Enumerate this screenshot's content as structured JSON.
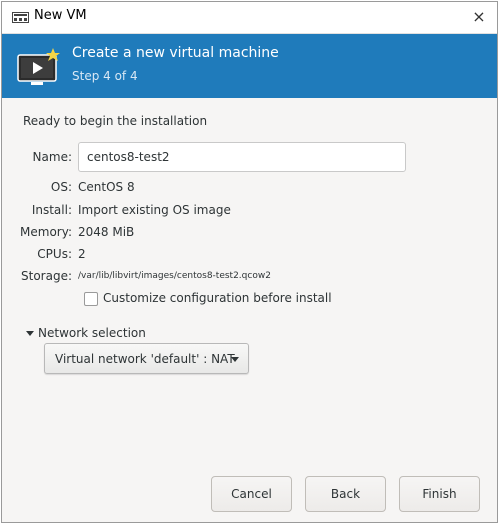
{
  "window": {
    "title": "New VM",
    "close_glyph": "×"
  },
  "banner": {
    "heading": "Create a new virtual machine",
    "step": "Step 4 of 4",
    "icon": "vm-monitor-icon"
  },
  "summary": {
    "ready_text": "Ready to begin the installation",
    "name_label": "Name:",
    "name_value": "centos8-test2",
    "os_label": "OS:",
    "os_value": "CentOS 8",
    "install_label": "Install:",
    "install_value": "Import existing OS image",
    "memory_label": "Memory:",
    "memory_value": "2048 MiB",
    "cpus_label": "CPUs:",
    "cpus_value": "2",
    "storage_label": "Storage:",
    "storage_value": "/var/lib/libvirt/images/centos8-test2.qcow2",
    "customize_label": "Customize configuration before install",
    "customize_checked": false
  },
  "network": {
    "expander_label": "Network selection",
    "selected": "Virtual network 'default' : NAT"
  },
  "buttons": {
    "cancel": "Cancel",
    "back": "Back",
    "finish": "Finish"
  },
  "colors": {
    "banner": "#1f7bbb",
    "window_bg": "#f6f5f4"
  }
}
